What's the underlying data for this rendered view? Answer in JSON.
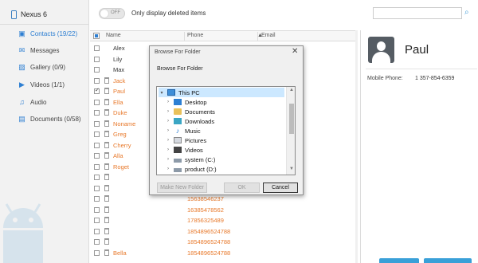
{
  "sidebar": {
    "device": "Nexus 6",
    "items": [
      {
        "label": "Contacts (19/22)",
        "icon": "contacts-icon"
      },
      {
        "label": "Messages",
        "icon": "messages-icon"
      },
      {
        "label": "Gallery (0/9)",
        "icon": "gallery-icon"
      },
      {
        "label": "Videos (1/1)",
        "icon": "videos-icon"
      },
      {
        "label": "Audio",
        "icon": "audio-icon"
      },
      {
        "label": "Documents (0/58)",
        "icon": "documents-icon"
      }
    ]
  },
  "topbar": {
    "toggle_label": "OFF",
    "only_deleted_label": "Only display deleted items",
    "search_placeholder": ""
  },
  "table": {
    "columns": [
      "Name",
      "Phone",
      "Email"
    ],
    "rows": [
      {
        "name": "Alex",
        "phone": "",
        "deleted": false,
        "checked": false
      },
      {
        "name": "Lily",
        "phone": "",
        "deleted": false,
        "checked": false
      },
      {
        "name": "Max",
        "phone": "",
        "deleted": false,
        "checked": false
      },
      {
        "name": "Jack",
        "phone": "",
        "deleted": true,
        "checked": false
      },
      {
        "name": "Paul",
        "phone": "",
        "deleted": true,
        "checked": true
      },
      {
        "name": "Ella",
        "phone": "",
        "deleted": true,
        "checked": false
      },
      {
        "name": "Duke",
        "phone": "",
        "deleted": true,
        "checked": false
      },
      {
        "name": "Noname",
        "phone": "",
        "deleted": true,
        "checked": false
      },
      {
        "name": "Greg",
        "phone": "",
        "deleted": true,
        "checked": false
      },
      {
        "name": "Cherry",
        "phone": "",
        "deleted": true,
        "checked": false
      },
      {
        "name": "Alla",
        "phone": "",
        "deleted": true,
        "checked": false
      },
      {
        "name": "Roget",
        "phone": "",
        "deleted": true,
        "checked": false
      },
      {
        "name": "",
        "phone": "",
        "deleted": true,
        "checked": false
      },
      {
        "name": "",
        "phone": "",
        "deleted": true,
        "checked": false
      },
      {
        "name": "",
        "phone": "15638546237",
        "deleted": true,
        "checked": false
      },
      {
        "name": "",
        "phone": "16385478562",
        "deleted": true,
        "checked": false
      },
      {
        "name": "",
        "phone": "17856325489",
        "deleted": true,
        "checked": false
      },
      {
        "name": "",
        "phone": "1854896524788",
        "deleted": true,
        "checked": false
      },
      {
        "name": "",
        "phone": "1854896524788",
        "deleted": true,
        "checked": false
      },
      {
        "name": "Bella",
        "phone": "1854896524788",
        "deleted": true,
        "checked": false
      }
    ]
  },
  "detail": {
    "name": "Paul",
    "mobile_label": "Mobile Phone:",
    "mobile_value": "1 357-854-6359"
  },
  "dialog": {
    "title": "Browse For Folder",
    "subtitle": "Browse For Folder",
    "close_glyph": "✕",
    "tree": [
      {
        "label": "This PC",
        "icon": "pc",
        "level": 0,
        "arrow": "▾",
        "selected": true
      },
      {
        "label": "Desktop",
        "icon": "blue",
        "level": 1,
        "arrow": "›",
        "selected": false
      },
      {
        "label": "Documents",
        "icon": "folder",
        "level": 1,
        "arrow": "›",
        "selected": false
      },
      {
        "label": "Downloads",
        "icon": "green",
        "level": 1,
        "arrow": "›",
        "selected": false
      },
      {
        "label": "Music",
        "icon": "music",
        "level": 1,
        "arrow": "›",
        "selected": false
      },
      {
        "label": "Pictures",
        "icon": "pics",
        "level": 1,
        "arrow": "›",
        "selected": false
      },
      {
        "label": "Videos",
        "icon": "vids",
        "level": 1,
        "arrow": "›",
        "selected": false
      },
      {
        "label": "system (C:)",
        "icon": "drive",
        "level": 1,
        "arrow": "›",
        "selected": false
      },
      {
        "label": "product (D:)",
        "icon": "drive",
        "level": 1,
        "arrow": "›",
        "selected": false
      }
    ],
    "buttons": {
      "new_folder": "Make New Folder",
      "ok": "OK",
      "cancel": "Cancel"
    }
  },
  "colors": {
    "accent": "#2e7fd2",
    "deleted_text": "#e8792b"
  }
}
